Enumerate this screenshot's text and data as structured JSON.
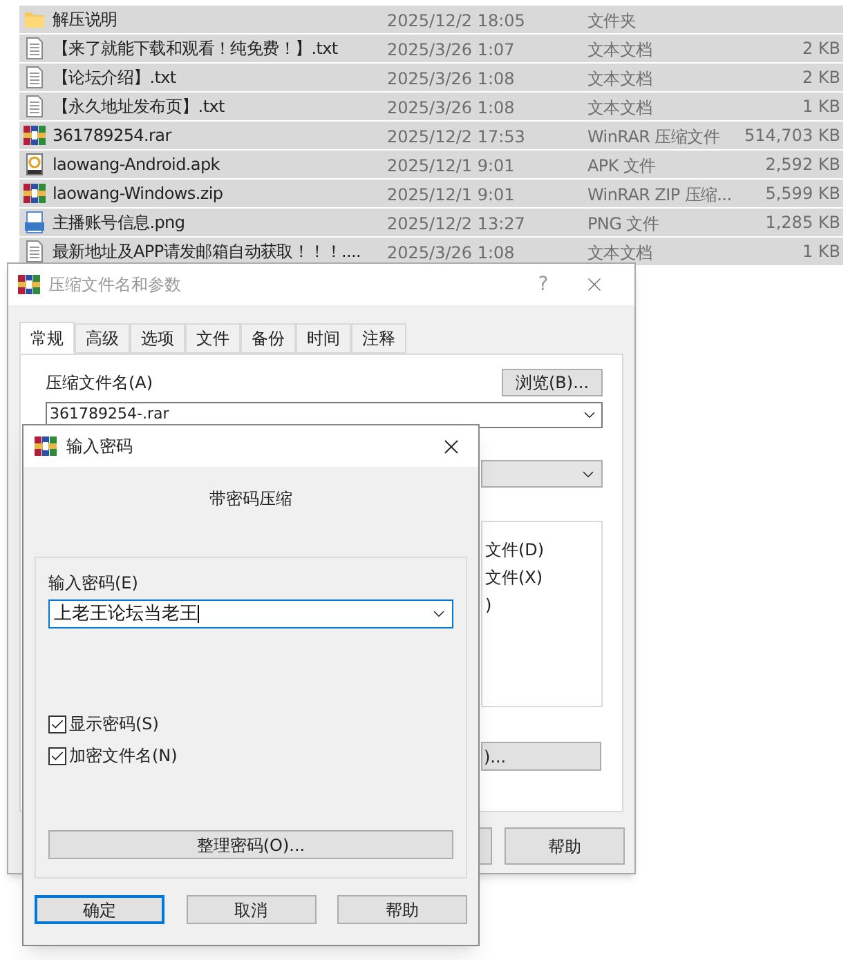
{
  "files": [
    {
      "kind": "folder",
      "name": "解压说明",
      "date": "2025/12/2 18:05",
      "type": "文件夹",
      "selected": true
    },
    {
      "kind": "text",
      "name": "【来了就能下载和观看！纯免费！】.txt",
      "date": "2025/3/26 1:07",
      "type": "文本文档",
      "size": "2 KB",
      "selected": true
    },
    {
      "kind": "text",
      "name": "【论坛介绍】.txt",
      "date": "2025/3/26 1:08",
      "type": "文本文档",
      "size": "2 KB",
      "selected": true
    },
    {
      "kind": "text",
      "name": "【永久地址发布页】.txt",
      "date": "2025/3/26 1:08",
      "type": "文本文档",
      "size": "1 KB",
      "selected": true
    },
    {
      "kind": "archive",
      "name": "361789254.rar",
      "date": "2025/12/2 17:53",
      "type": "WinRAR 压缩文件",
      "size": "514,703 KB",
      "selected": true
    },
    {
      "kind": "apk",
      "name": "laowang-Android.apk",
      "date": "2025/12/1 9:01",
      "type": "APK 文件",
      "size": "2,592 KB",
      "selected": true
    },
    {
      "kind": "archive",
      "name": "laowang-Windows.zip",
      "date": "2025/12/1 9:01",
      "type": "WinRAR ZIP 压缩...",
      "size": "5,599 KB",
      "selected": true
    },
    {
      "kind": "image",
      "name": "主播账号信息.png",
      "date": "2025/12/2 13:27",
      "type": "PNG 文件",
      "size": "1,285 KB",
      "selected": true
    },
    {
      "kind": "text",
      "name": "最新地址及APP请发邮箱自动获取！！！....",
      "date": "2025/3/26 1:08",
      "type": "文本文档",
      "size": "1 KB",
      "selected": true
    }
  ],
  "archive_dialog": {
    "title": "压缩文件名和参数",
    "help_glyph": "?",
    "tabs": [
      {
        "label": "常规",
        "selected": true
      },
      {
        "label": "高级",
        "selected": false
      },
      {
        "label": "选项",
        "selected": false
      },
      {
        "label": "文件",
        "selected": false
      },
      {
        "label": "备份",
        "selected": false
      },
      {
        "label": "时间",
        "selected": false
      },
      {
        "label": "注释",
        "selected": false
      }
    ],
    "archive_name_label": "压缩文件名(A)",
    "browse_button": "浏览(B)...",
    "archive_name": "361789254-.rar",
    "option_fragments": [
      "文件(D)",
      "文件(X)",
      ")"
    ],
    "button_fragment": ")...",
    "help_button": "帮助"
  },
  "password_dialog": {
    "title": "输入密码",
    "heading": "带密码压缩",
    "password_label": "输入密码(E)",
    "password": "上老王论坛当老王",
    "checkboxes": [
      {
        "label": "显示密码(S)",
        "checked": true
      },
      {
        "label": "加密文件名(N)",
        "checked": true
      }
    ],
    "organize_button": "整理密码(O)...",
    "buttons": [
      {
        "label": "确定",
        "default": true
      },
      {
        "label": "取消",
        "default": false
      },
      {
        "label": "帮助",
        "default": false
      }
    ]
  }
}
